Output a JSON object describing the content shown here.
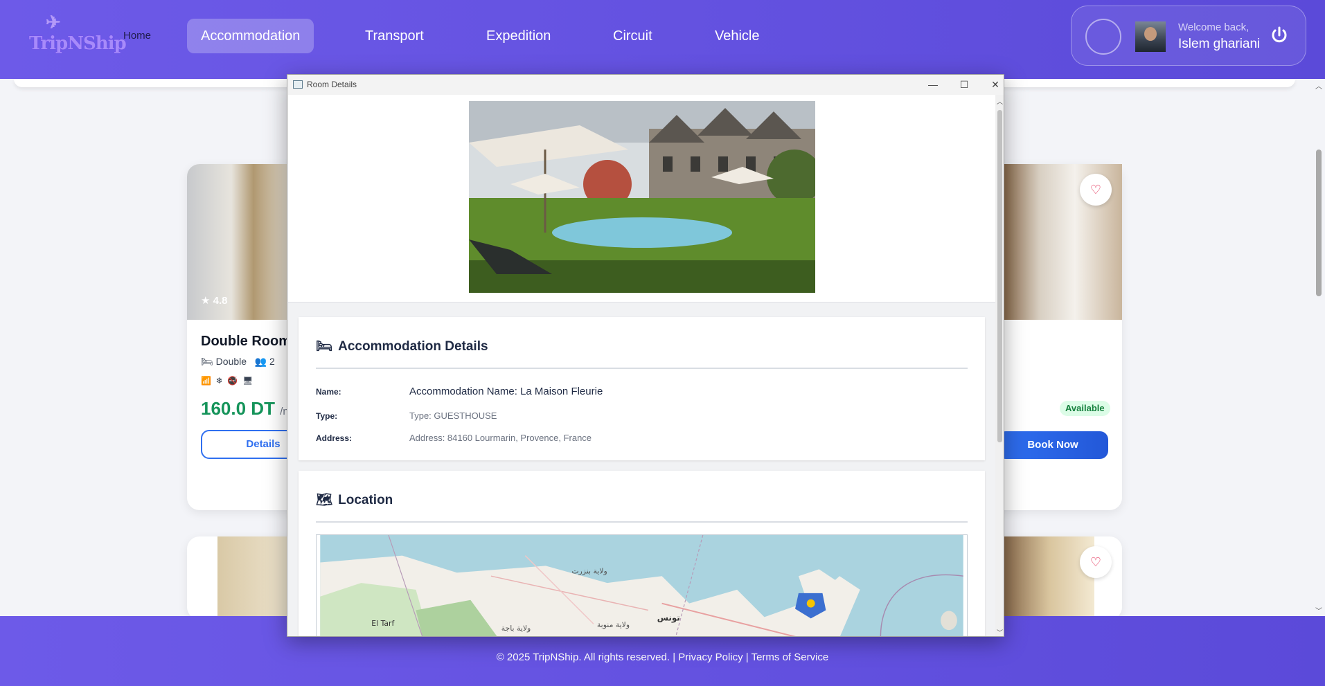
{
  "header": {
    "logo_text": "TripNShip",
    "nav": {
      "home": "Home",
      "items": [
        "Accommodation",
        "Transport",
        "Expedition",
        "Circuit",
        "Vehicle"
      ],
      "active": "Accommodation"
    },
    "user": {
      "welcome": "Welcome back,",
      "name": "Islem ghariani"
    }
  },
  "background_cards": {
    "left": {
      "rating": "★ 4.8",
      "title": "Double Room",
      "room_type": "Double",
      "capacity": "2",
      "price": "160.0 DT",
      "price_suffix": "/n",
      "details_label": "Details"
    },
    "right": {
      "status": "Available",
      "book_label": "Book Now"
    }
  },
  "modal": {
    "window_title": "Room Details",
    "details_section": {
      "heading": "Accommodation Details",
      "name_label": "Name:",
      "name_value": "Accommodation Name: La Maison Fleurie",
      "type_label": "Type:",
      "type_value": "Type: GUESTHOUSE",
      "address_label": "Address:",
      "address_value": "Address: 84160 Lourmarin, Provence, France"
    },
    "location_section": {
      "heading": "Location",
      "map_labels": [
        "ولاية بنزرت",
        "El Tarf",
        "ولاية باجة",
        "ولاية منوبة",
        "تونس"
      ]
    }
  },
  "footer": {
    "copyright": "© 2025 TripNShip. All rights reserved. | Privacy Policy | Terms of Service"
  },
  "colors": {
    "brand": "#5b4ad9",
    "price_green": "#15945a",
    "button_blue": "#2f6ff0",
    "heart_red": "#e11d48"
  }
}
